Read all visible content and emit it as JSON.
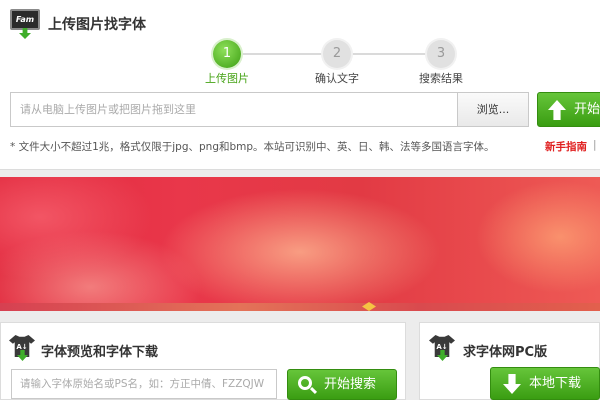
{
  "upload": {
    "title": "上传图片找字体",
    "logo_text": "Fam",
    "steps": [
      {
        "number": "1",
        "label": "上传图片",
        "state": "active"
      },
      {
        "number": "2",
        "label": "确认文字",
        "state": "inactive"
      },
      {
        "number": "3",
        "label": "搜索结果",
        "state": "inactive"
      }
    ],
    "file_placeholder": "请从电脑上传图片或把图片拖到这里",
    "browse_label": "浏览...",
    "start_label": "开始",
    "hint": "* 文件大小不超过1兆，格式仅限于jpg、png和bmp。本站可识别中、英、日、韩、法等多国语言字体。",
    "guide_link": "新手指南",
    "separator": "|"
  },
  "preview": {
    "title": "字体预览和字体下载",
    "icon_text": "A↓",
    "search_placeholder": "请输入字体原始名或PS名，如：方正中倩、FZZQJW",
    "search_label": "开始搜索"
  },
  "pc": {
    "title": "求字体网PC版",
    "icon_text": "A↓",
    "download_label": "本地下载"
  },
  "colors": {
    "accent_green": "#46a316",
    "link_red": "#e02020",
    "banner_red": "#e1283d"
  },
  "icons": [
    "monitor-upload-icon",
    "upload-arrow-icon",
    "shirt-font-icon",
    "search-icon",
    "download-arrow-icon"
  ]
}
